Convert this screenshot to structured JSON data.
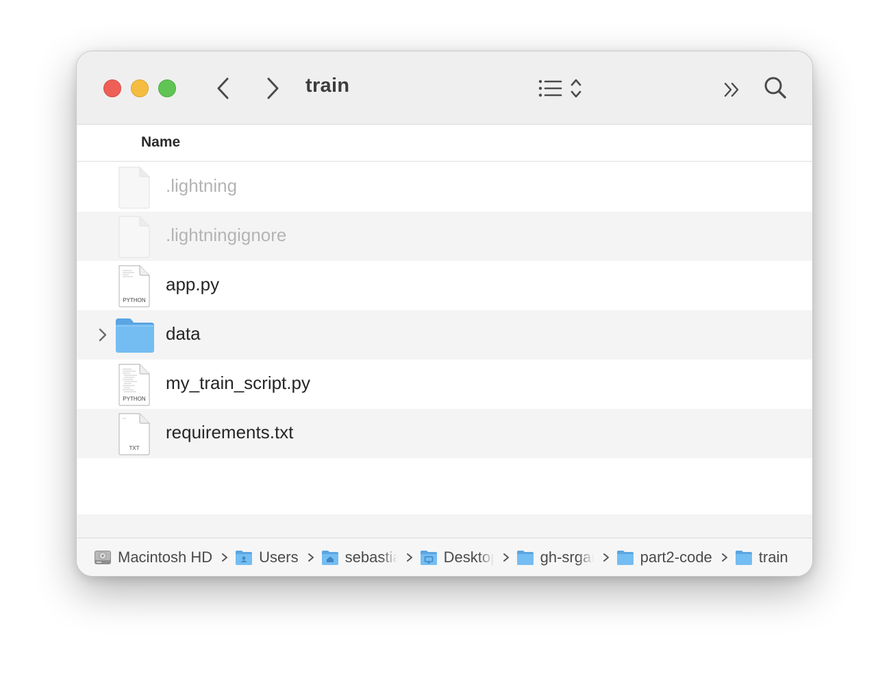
{
  "window": {
    "title": "train"
  },
  "toolbar": {
    "back_icon": "chevron-left-icon",
    "forward_icon": "chevron-right-icon",
    "view_icon": "list-view-icon",
    "more_icon": "double-chevron-right-icon",
    "search_icon": "magnifier-icon"
  },
  "columns": {
    "name": "Name"
  },
  "files": [
    {
      "name": ".lightning",
      "kind": "document",
      "badge": "",
      "hidden": true
    },
    {
      "name": ".lightningignore",
      "kind": "document",
      "badge": "",
      "hidden": true
    },
    {
      "name": "app.py",
      "kind": "python",
      "badge": "PYTHON",
      "hidden": false
    },
    {
      "name": "data",
      "kind": "folder",
      "badge": "",
      "hidden": false
    },
    {
      "name": "my_train_script.py",
      "kind": "python",
      "badge": "PYTHON",
      "hidden": false
    },
    {
      "name": "requirements.txt",
      "kind": "text",
      "badge": "TXT",
      "hidden": false
    }
  ],
  "pathbar": [
    {
      "label": "Macintosh HD",
      "icon": "hard-drive-icon"
    },
    {
      "label": "Users",
      "icon": "users-folder-icon"
    },
    {
      "label": "sebastian",
      "icon": "home-folder-icon"
    },
    {
      "label": "Desktop",
      "icon": "desktop-folder-icon"
    },
    {
      "label": "gh-srgan",
      "icon": "folder-icon"
    },
    {
      "label": "part2-code",
      "icon": "folder-icon"
    },
    {
      "label": "train",
      "icon": "folder-icon"
    }
  ],
  "colors": {
    "close": "#ed5f57",
    "minimize": "#f5bd3f",
    "maximize": "#5fc454",
    "folder": "#6db3ec"
  }
}
